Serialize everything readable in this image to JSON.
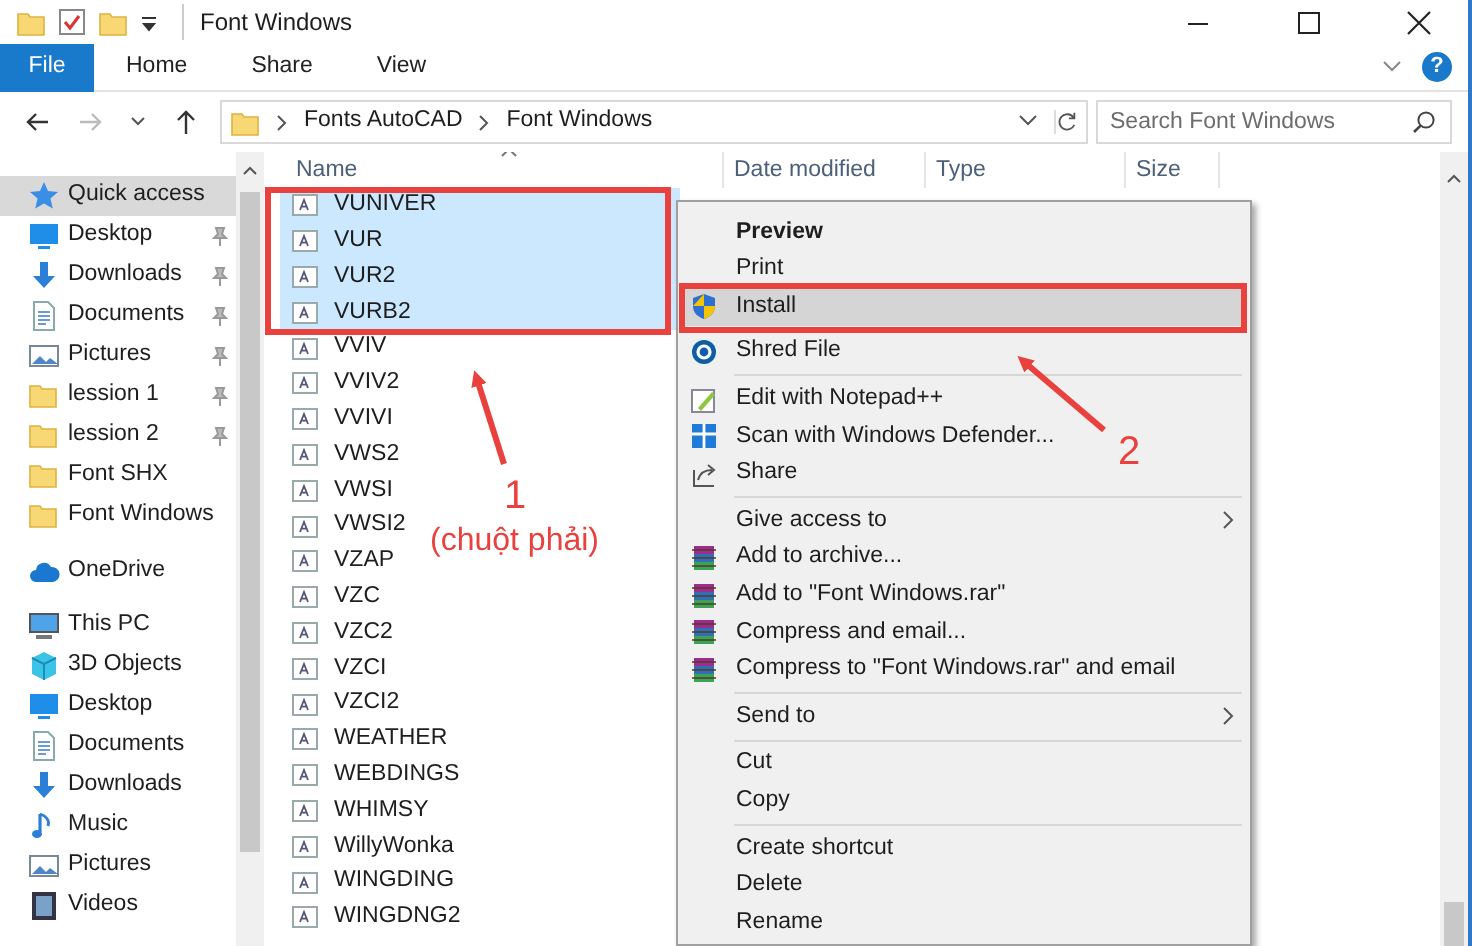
{
  "window": {
    "title": "Font Windows"
  },
  "ribbon": {
    "tabs": [
      {
        "label": "File",
        "selected": true
      },
      {
        "label": "Home",
        "selected": false
      },
      {
        "label": "Share",
        "selected": false
      },
      {
        "label": "View",
        "selected": false
      }
    ],
    "help": "?"
  },
  "address": {
    "breadcrumbs": [
      "Fonts AutoCAD",
      "Font Windows"
    ],
    "search": {
      "placeholder": "Search Font Windows"
    }
  },
  "sidebar": {
    "items": [
      {
        "label": "Quick access",
        "kind": "star",
        "selected": true,
        "pinned": false
      },
      {
        "label": "Desktop",
        "kind": "desktop",
        "selected": false,
        "pinned": true
      },
      {
        "label": "Downloads",
        "kind": "download",
        "selected": false,
        "pinned": true
      },
      {
        "label": "Documents",
        "kind": "document",
        "selected": false,
        "pinned": true
      },
      {
        "label": "Pictures",
        "kind": "picture",
        "selected": false,
        "pinned": true
      },
      {
        "label": "lession 1",
        "kind": "folder",
        "selected": false,
        "pinned": true
      },
      {
        "label": "lession 2",
        "kind": "folder",
        "selected": false,
        "pinned": true
      },
      {
        "label": "Font SHX",
        "kind": "folder",
        "selected": false,
        "pinned": false
      },
      {
        "label": "Font Windows",
        "kind": "folder",
        "selected": false,
        "pinned": false
      },
      {
        "label": "OneDrive",
        "kind": "cloud",
        "selected": false,
        "pinned": false
      },
      {
        "label": "This PC",
        "kind": "pc",
        "selected": false,
        "pinned": false
      },
      {
        "label": "3D Objects",
        "kind": "cube",
        "selected": false,
        "pinned": false
      },
      {
        "label": "Desktop",
        "kind": "desktop",
        "selected": false,
        "pinned": false
      },
      {
        "label": "Documents",
        "kind": "document",
        "selected": false,
        "pinned": false
      },
      {
        "label": "Downloads",
        "kind": "download",
        "selected": false,
        "pinned": false
      },
      {
        "label": "Music",
        "kind": "music",
        "selected": false,
        "pinned": false
      },
      {
        "label": "Pictures",
        "kind": "picture",
        "selected": false,
        "pinned": false
      },
      {
        "label": "Videos",
        "kind": "video",
        "selected": false,
        "pinned": false
      }
    ]
  },
  "file_list": {
    "columns": [
      "Name",
      "Date modified",
      "Type",
      "Size"
    ],
    "files": [
      {
        "name": "VUNIVER",
        "selected": true
      },
      {
        "name": "VUR",
        "selected": true
      },
      {
        "name": "VUR2",
        "selected": true
      },
      {
        "name": "VURB2",
        "selected": true
      },
      {
        "name": "VVIV",
        "selected": false
      },
      {
        "name": "VVIV2",
        "selected": false
      },
      {
        "name": "VVIVI",
        "selected": false
      },
      {
        "name": "VWS2",
        "selected": false
      },
      {
        "name": "VWSI",
        "selected": false
      },
      {
        "name": "VWSI2",
        "selected": false
      },
      {
        "name": "VZAP",
        "selected": false
      },
      {
        "name": "VZC",
        "selected": false
      },
      {
        "name": "VZC2",
        "selected": false
      },
      {
        "name": "VZCI",
        "selected": false
      },
      {
        "name": "VZCI2",
        "selected": false
      },
      {
        "name": "WEATHER",
        "selected": false
      },
      {
        "name": "WEBDINGS",
        "selected": false
      },
      {
        "name": "WHIMSY",
        "selected": false
      },
      {
        "name": "WillyWonka",
        "selected": false
      },
      {
        "name": "WINGDING",
        "selected": false
      },
      {
        "name": "WINGDNG2",
        "selected": false
      }
    ]
  },
  "context_menu": {
    "items": [
      {
        "kind": "plain",
        "label": "Preview",
        "default": true,
        "highlighted": false,
        "submenu": false
      },
      {
        "kind": "plain",
        "label": "Print",
        "default": false,
        "highlighted": false,
        "submenu": false
      },
      {
        "kind": "shield",
        "label": "Install",
        "default": false,
        "highlighted": true,
        "submenu": false
      },
      {
        "kind": "shred",
        "label": "Shred File",
        "default": false,
        "highlighted": false,
        "submenu": false
      },
      {
        "kind": "separator"
      },
      {
        "kind": "notepad",
        "label": "Edit with Notepad++",
        "default": false,
        "highlighted": false,
        "submenu": false
      },
      {
        "kind": "defender",
        "label": "Scan with Windows Defender...",
        "default": false,
        "highlighted": false,
        "submenu": false
      },
      {
        "kind": "share",
        "label": "Share",
        "default": false,
        "highlighted": false,
        "submenu": false
      },
      {
        "kind": "separator"
      },
      {
        "kind": "plain",
        "label": "Give access to",
        "default": false,
        "highlighted": false,
        "submenu": true
      },
      {
        "kind": "archive",
        "label": "Add to archive...",
        "default": false,
        "highlighted": false,
        "submenu": false
      },
      {
        "kind": "archive",
        "label": "Add to \"Font Windows.rar\"",
        "default": false,
        "highlighted": false,
        "submenu": false
      },
      {
        "kind": "archive",
        "label": "Compress and email...",
        "default": false,
        "highlighted": false,
        "submenu": false
      },
      {
        "kind": "archive",
        "label": "Compress to \"Font Windows.rar\" and email",
        "default": false,
        "highlighted": false,
        "submenu": false
      },
      {
        "kind": "separator"
      },
      {
        "kind": "plain",
        "label": "Send to",
        "default": false,
        "highlighted": false,
        "submenu": true
      },
      {
        "kind": "separator"
      },
      {
        "kind": "plain",
        "label": "Cut",
        "default": false,
        "highlighted": false,
        "submenu": false
      },
      {
        "kind": "plain",
        "label": "Copy",
        "default": false,
        "highlighted": false,
        "submenu": false
      },
      {
        "kind": "separator"
      },
      {
        "kind": "plain",
        "label": "Create shortcut",
        "default": false,
        "highlighted": false,
        "submenu": false
      },
      {
        "kind": "plain",
        "label": "Delete",
        "default": false,
        "highlighted": false,
        "submenu": false
      },
      {
        "kind": "plain",
        "label": "Rename",
        "default": false,
        "highlighted": false,
        "submenu": false
      }
    ]
  },
  "annotations": [
    {
      "number": "1",
      "note": "(chuột phải)"
    },
    {
      "number": "2"
    }
  ]
}
